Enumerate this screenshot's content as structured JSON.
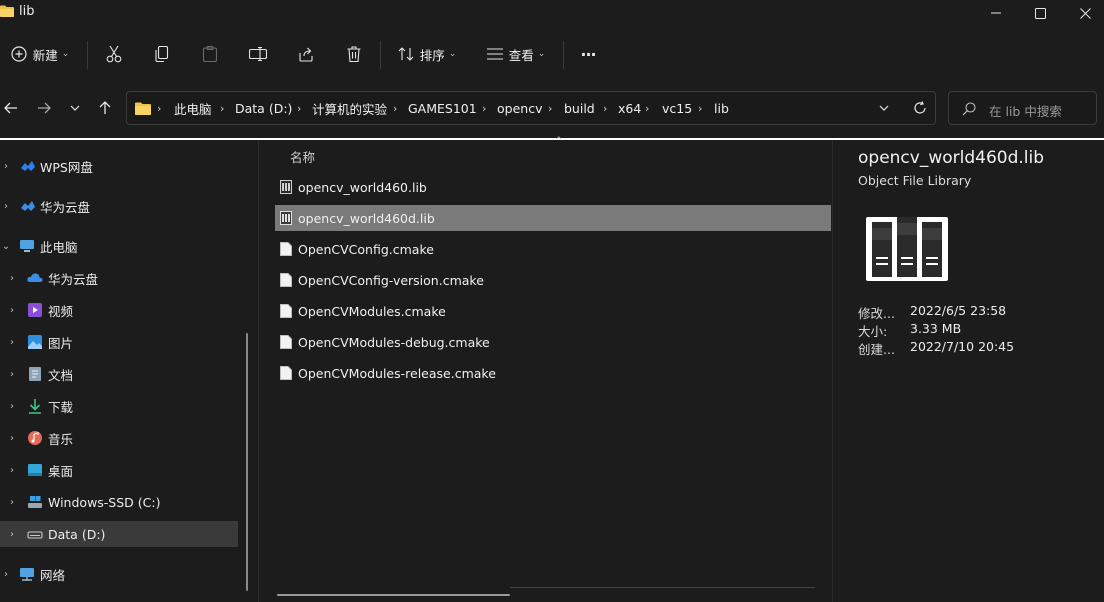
{
  "window": {
    "title": "lib"
  },
  "toolbar": {
    "new_label": "新建",
    "sort_label": "排序",
    "view_label": "查看",
    "more_label": "···"
  },
  "address": {
    "crumbs": [
      "此电脑",
      "Data (D:)",
      "计算机的实验",
      "GAMES101",
      "opencv",
      "build",
      "x64",
      "vc15",
      "lib"
    ]
  },
  "search": {
    "placeholder": "在 lib 中搜索"
  },
  "nav": {
    "items": [
      {
        "label": "WPS网盘",
        "icon": "wps-cloud-icon"
      },
      {
        "label": "华为云盘",
        "icon": "huawei-cloud-icon"
      },
      {
        "label": "此电脑",
        "icon": "this-pc-icon"
      },
      {
        "label": "华为云盘",
        "icon": "huawei-cloud-icon"
      },
      {
        "label": "视频",
        "icon": "videos-icon"
      },
      {
        "label": "图片",
        "icon": "pictures-icon"
      },
      {
        "label": "文档",
        "icon": "documents-icon"
      },
      {
        "label": "下载",
        "icon": "downloads-icon"
      },
      {
        "label": "音乐",
        "icon": "music-icon"
      },
      {
        "label": "桌面",
        "icon": "desktop-icon"
      },
      {
        "label": "Windows-SSD (C:)",
        "icon": "drive-c-icon"
      },
      {
        "label": "Data (D:)",
        "icon": "drive-d-icon"
      },
      {
        "label": "网络",
        "icon": "network-icon"
      }
    ]
  },
  "filelist": {
    "column_name": "名称",
    "files": [
      {
        "name": "opencv_world460.lib",
        "icon": "library-file-icon"
      },
      {
        "name": "opencv_world460d.lib",
        "icon": "library-file-icon"
      },
      {
        "name": "OpenCVConfig.cmake",
        "icon": "document-file-icon"
      },
      {
        "name": "OpenCVConfig-version.cmake",
        "icon": "document-file-icon"
      },
      {
        "name": "OpenCVModules.cmake",
        "icon": "document-file-icon"
      },
      {
        "name": "OpenCVModules-debug.cmake",
        "icon": "document-file-icon"
      },
      {
        "name": "OpenCVModules-release.cmake",
        "icon": "document-file-icon"
      }
    ],
    "selected": "opencv_world460d.lib"
  },
  "details": {
    "name": "opencv_world460d.lib",
    "type": "Object File Library",
    "modified_key": "修改...",
    "modified": "2022/6/5 23:58",
    "size_key": "大小:",
    "size": "3.33 MB",
    "created_key": "创建...",
    "created": "2022/7/10 20:45"
  },
  "colors": {
    "accent": "#60cdff",
    "folder": "#f3c142",
    "selection": "#7a7a7a"
  }
}
